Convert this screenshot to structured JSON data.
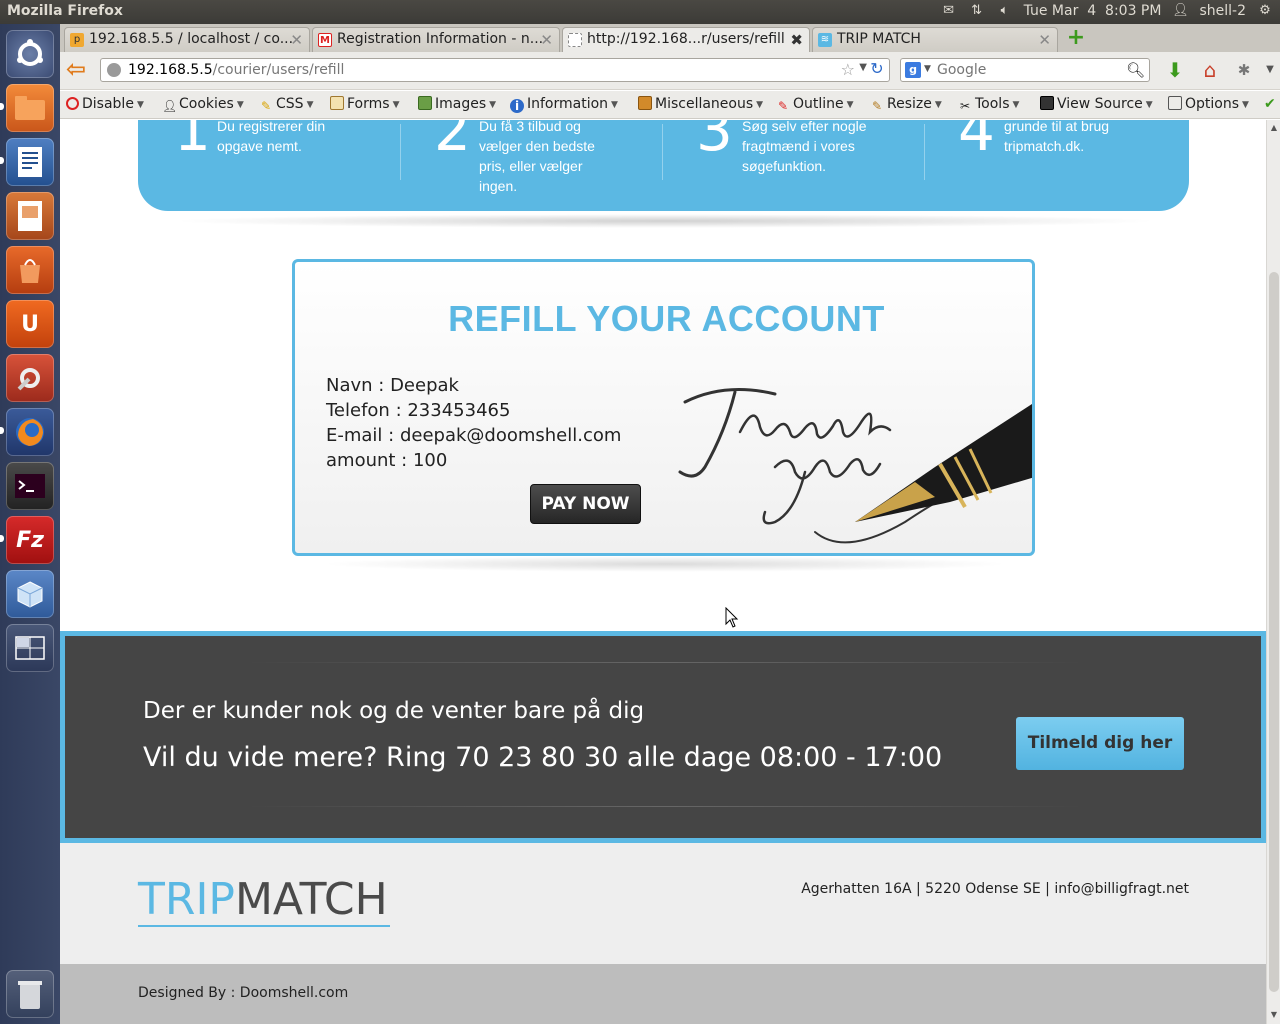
{
  "panel": {
    "window_title": "Mozilla Firefox",
    "clock": "Tue Mar  4  8:03 PM",
    "user": "shell-2"
  },
  "launcher": {
    "items": [
      "dash-home-icon",
      "files-icon",
      "writer-icon",
      "impress-icon",
      "software-center-icon",
      "ubuntu-one-icon",
      "system-settings-icon",
      "firefox-icon",
      "terminal-icon",
      "filezilla-icon",
      "virtualbox-icon",
      "workspace-switcher-icon",
      "trash-icon"
    ]
  },
  "browser": {
    "tabs": [
      {
        "label": "192.168.5.5 / localhost / co..."
      },
      {
        "label": "Registration Information - n..."
      },
      {
        "label": "http://192.168...r/users/refill"
      },
      {
        "label": "TRIP MATCH"
      }
    ],
    "url_host": "192.168.5.5",
    "url_path": "/courier/users/refill",
    "search_placeholder": "Google"
  },
  "devtoolbar": {
    "items": [
      "Disable",
      "Cookies",
      "CSS",
      "Forms",
      "Images",
      "Information",
      "Miscellaneous",
      "Outline",
      "Resize",
      "Tools",
      "View Source",
      "Options"
    ]
  },
  "page": {
    "steps": [
      {
        "num": "1",
        "text": "Du registrerer din opgave nemt."
      },
      {
        "num": "2",
        "text": "Du få 3 tilbud og vælger den bedste pris, eller vælger ingen."
      },
      {
        "num": "3",
        "text": "Søg selv efter nogle fragtmænd i vores søgefunktion."
      },
      {
        "num": "4",
        "text": "grunde til at brug tripmatch.dk."
      }
    ],
    "refill": {
      "title": "REFILL YOUR ACCOUNT",
      "name_line": "Navn : Deepak",
      "phone_line": "Telefon : 233453465",
      "email_line": "E-mail : deepak@doomshell.com",
      "amount_line": "amount : 100",
      "pay_button": "PAY NOW"
    },
    "cta": {
      "line1": "Der er kunder nok og de venter bare på dig",
      "line2": "Vil du vide mere? Ring 70 23 80 30 alle dage 08:00 - 17:00",
      "button": "Tilmeld dig her"
    },
    "footer": {
      "logo_part1": "TRIP",
      "logo_part2": "MATCH",
      "address": "Agerhatten 16A | 5220 Odense SE | info@billigfragt.net",
      "designed_by": "Designed By : Doomshell.com"
    }
  },
  "colors": {
    "accent": "#5bb8e3",
    "cta_bg": "#454545",
    "launcher_bg": "#2f3b59"
  }
}
